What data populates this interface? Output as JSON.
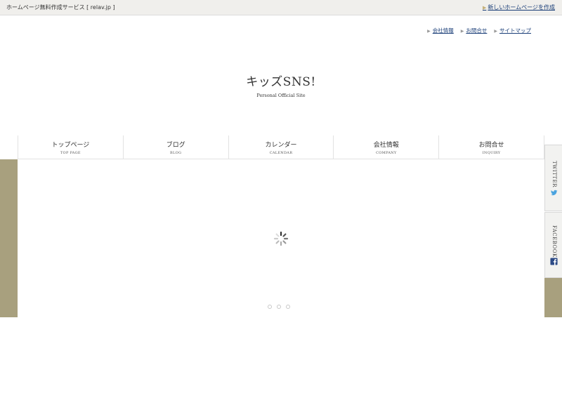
{
  "topbar": {
    "service": "ホームページ無料作成サービス [ relav.jp ]",
    "new_site_link": "新しいホームページを作成"
  },
  "util_links": [
    "会社情報",
    "お問合せ",
    "サイトマップ"
  ],
  "brand": {
    "title": "キッズSNS!",
    "subtitle": "Personal Official Site"
  },
  "nav": [
    {
      "jp": "トップページ",
      "en": "TOP PAGE"
    },
    {
      "jp": "ブログ",
      "en": "BLOG"
    },
    {
      "jp": "カレンダー",
      "en": "CALENDAR"
    },
    {
      "jp": "会社情報",
      "en": "COMPANY"
    },
    {
      "jp": "お問合せ",
      "en": "INQUIRY"
    }
  ],
  "social": {
    "twitter": "TWITTER",
    "facebook": "FACEBOOK"
  },
  "icons": {
    "arrow": "arrow-right-icon",
    "twitter": "twitter-bird-icon",
    "facebook": "facebook-f-icon",
    "loading": "loading-spinner-icon"
  },
  "colors": {
    "accent_band": "#a8a07e",
    "link": "#1a3e78",
    "twitter": "#4aa3df",
    "facebook": "#2c4a86"
  },
  "slider": {
    "dot_count": 3
  }
}
